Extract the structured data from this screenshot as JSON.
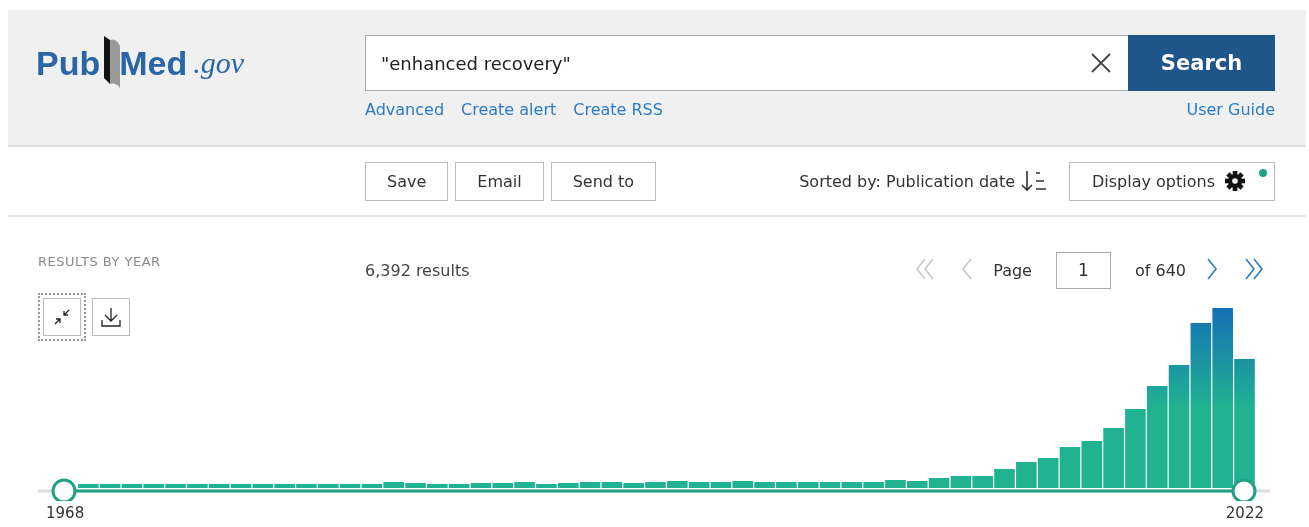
{
  "header": {
    "logo": {
      "first": "Pub",
      "second": "Med",
      "domain": ".gov"
    },
    "search": {
      "value": "\"enhanced recovery\"",
      "button": "Search"
    },
    "links": [
      "Advanced",
      "Create alert",
      "Create RSS"
    ],
    "user_guide": "User Guide"
  },
  "toolbar": {
    "actions": [
      "Save",
      "Email",
      "Send to"
    ],
    "sort": "Sorted by: Publication date",
    "display_options": {
      "label": "Display options",
      "badge": true
    }
  },
  "results": {
    "heading": "RESULTS BY YEAR",
    "collapse": {
      "focused": true
    },
    "count": "6,392 results",
    "pagination": {
      "before": [
        {
          "kind": "first",
          "disabled": true
        },
        {
          "kind": "prev",
          "disabled": true
        }
      ],
      "label": "Page",
      "page": "1",
      "total": "of 640",
      "after": [
        {
          "kind": "next",
          "disabled": false
        },
        {
          "kind": "last",
          "disabled": false
        }
      ]
    },
    "years": {
      "start": "1968",
      "end": "2022"
    }
  }
}
